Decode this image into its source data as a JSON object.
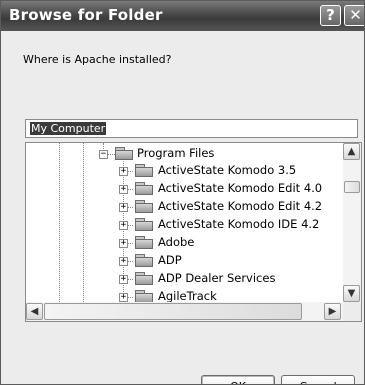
{
  "window": {
    "title": "Browse for Folder",
    "help_label": "?",
    "close_label": "✕"
  },
  "prompt": "Where is Apache installed?",
  "folder_field": {
    "value": "My Computer"
  },
  "tree": {
    "parent": {
      "label": "Program Files",
      "expander": "−"
    },
    "items": [
      {
        "label": "ActiveState Komodo 3.5",
        "expander": "+"
      },
      {
        "label": "ActiveState Komodo Edit 4.0",
        "expander": "+"
      },
      {
        "label": "ActiveState Komodo Edit 4.2",
        "expander": "+"
      },
      {
        "label": "ActiveState Komodo IDE 4.2",
        "expander": "+"
      },
      {
        "label": "Adobe",
        "expander": "+"
      },
      {
        "label": "ADP",
        "expander": "+"
      },
      {
        "label": "ADP Dealer Services",
        "expander": "+"
      },
      {
        "label": "AgileTrack",
        "expander": "+"
      }
    ]
  },
  "scroll": {
    "up": "▲",
    "down": "▼",
    "left": "◀",
    "right": "▶"
  },
  "buttons": {
    "ok": "OK",
    "cancel": "Cancel"
  },
  "colors": {
    "titlebar": "#474747",
    "dialog_bg": "#ececec"
  },
  "icons": {
    "folder": "folder-icon",
    "expand": "expand-icon",
    "collapse": "collapse-icon"
  }
}
